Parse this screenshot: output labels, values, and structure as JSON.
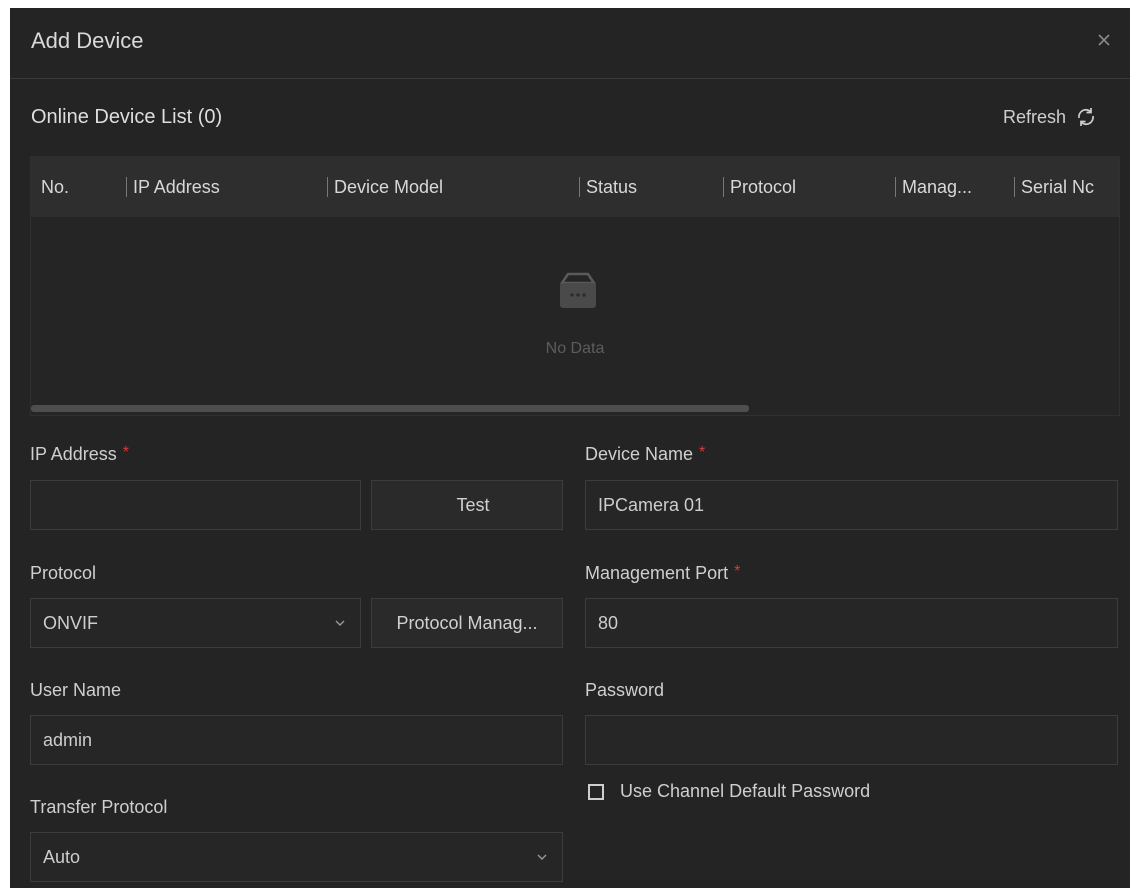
{
  "dialog": {
    "title": "Add Device"
  },
  "online_list": {
    "title": "Online Device List (0)",
    "refresh_label": "Refresh",
    "columns": [
      "No.",
      "IP Address",
      "Device Model",
      "Status",
      "Protocol",
      "Manag...",
      "Serial Nc"
    ],
    "empty_text": "No Data",
    "scroll_fraction": 0.66
  },
  "form": {
    "ip_address": {
      "label": "IP Address",
      "required": "*",
      "value": "",
      "test_label": "Test"
    },
    "device_name": {
      "label": "Device Name",
      "required": "*",
      "value": "IPCamera 01"
    },
    "protocol": {
      "label": "Protocol",
      "value": "ONVIF",
      "manage_label": "Protocol Manag..."
    },
    "management_port": {
      "label": "Management Port",
      "required": "*",
      "value": "80"
    },
    "user_name": {
      "label": "User Name",
      "value": "admin"
    },
    "password": {
      "label": "Password",
      "value": ""
    },
    "default_password": {
      "label": "Use Channel Default Password",
      "checked": false
    },
    "transfer_protocol": {
      "label": "Transfer Protocol",
      "value": "Auto"
    }
  },
  "icons": {
    "close": "close-icon",
    "refresh": "refresh-icon",
    "empty": "empty-box-icon",
    "dropdown": "chevron-down-icon"
  },
  "colors": {
    "background": "#242424",
    "header": "#2e2e2e",
    "required": "#d93a3a",
    "text": "#d6d6d6"
  }
}
